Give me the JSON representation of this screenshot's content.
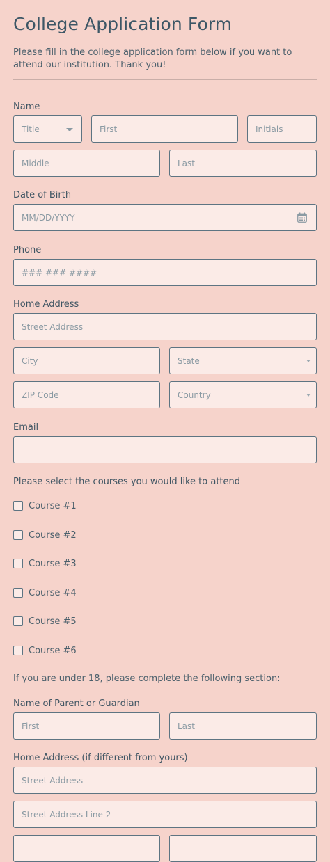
{
  "form": {
    "title": "College Application Form",
    "description": "Please fill in the college application form below if you want to attend our institution. Thank you!"
  },
  "name": {
    "label": "Name",
    "title_placeholder": "Title",
    "first_placeholder": "First",
    "initials_placeholder": "Initials",
    "middle_placeholder": "Middle",
    "last_placeholder": "Last"
  },
  "dob": {
    "label": "Date of Birth",
    "placeholder": "MM/DD/YYYY",
    "icon": "calendar-icon"
  },
  "phone": {
    "label": "Phone",
    "placeholder": "### ### ####"
  },
  "address": {
    "label": "Home Address",
    "street_placeholder": "Street Address",
    "city_placeholder": "City",
    "state_placeholder": "State",
    "zip_placeholder": "ZIP Code",
    "country_placeholder": "Country"
  },
  "email": {
    "label": "Email",
    "value": ""
  },
  "courses": {
    "label": "Please select the courses you would like to attend",
    "items": [
      {
        "label": "Course #1",
        "checked": false
      },
      {
        "label": "Course #2",
        "checked": false
      },
      {
        "label": "Course #3",
        "checked": false
      },
      {
        "label": "Course #4",
        "checked": false
      },
      {
        "label": "Course #5",
        "checked": false
      },
      {
        "label": "Course #6",
        "checked": false
      }
    ]
  },
  "minor_note": "If you are under 18, please complete the following section:",
  "guardian": {
    "label": "Name of Parent or Guardian",
    "first_placeholder": "First",
    "last_placeholder": "Last"
  },
  "guardian_address": {
    "label": "Home Address (if different from yours)",
    "street_placeholder": "Street Address",
    "street2_placeholder": "Street Address Line 2"
  },
  "colors": {
    "background": "#f6d3cb",
    "field_background": "#fbebe7",
    "border": "#5d7482",
    "text": "#3f5563"
  }
}
